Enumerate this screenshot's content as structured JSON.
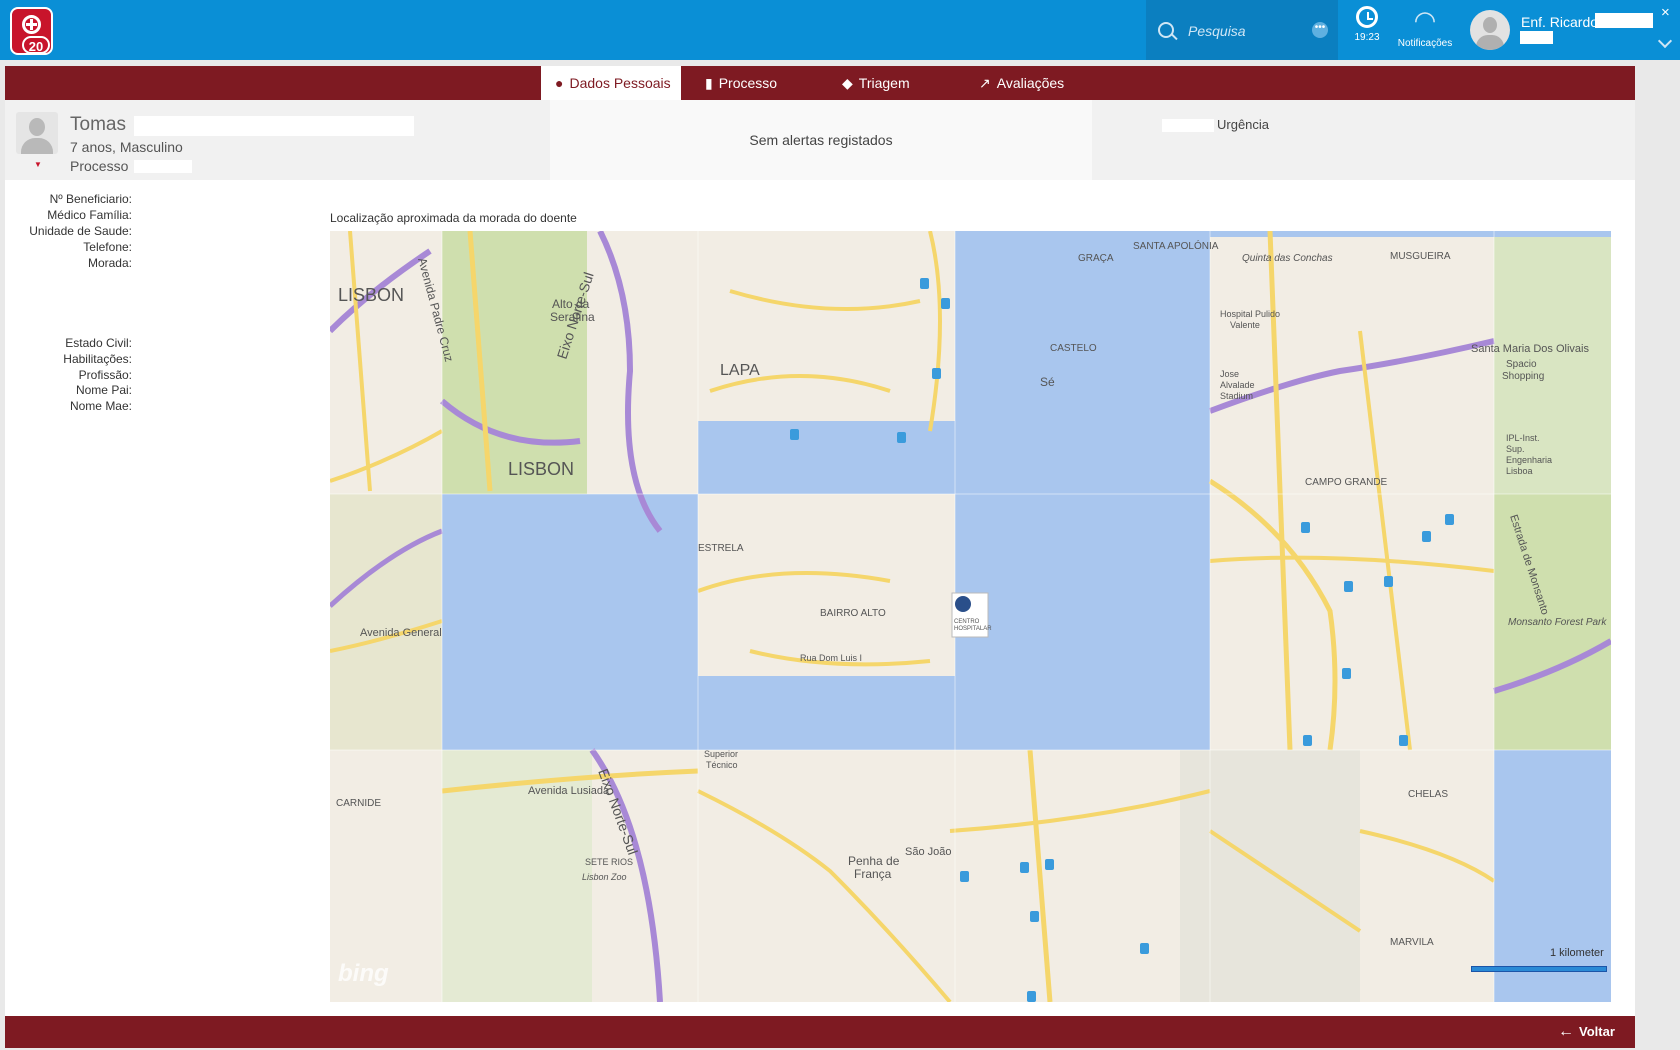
{
  "topbar": {
    "badge_count": "20",
    "search_placeholder": "Pesquisa",
    "clock_time": "19:23",
    "notifications_label": "Notificações",
    "user_name": "Enf. Ricardo",
    "close_symbol": "×"
  },
  "tabs": [
    {
      "label": "Dados Pessoais",
      "icon": "person-icon"
    },
    {
      "label": "Processo",
      "icon": "document-icon"
    },
    {
      "label": "Triagem",
      "icon": "tag-icon"
    },
    {
      "label": "Avaliações",
      "icon": "trend-icon"
    }
  ],
  "patient": {
    "name": "Tomas",
    "age_sex": "7 anos, Masculino",
    "process_label": "Processo",
    "alerts": "Sem alertas registados",
    "urgency": "Urgência"
  },
  "fields": [
    "Nº Beneficiario:",
    "Médico Família:",
    "Unidade de Saude:",
    "Telefone:",
    "Morada:",
    "Estado Civil:",
    "Habilitações:",
    "Profissão:",
    "Nome Pai:",
    "Nome Mae:"
  ],
  "map": {
    "title": "Localização aproximada da morada do doente",
    "scale_label": "1 kilometer",
    "provider": "bing",
    "labels": [
      "LISBON",
      "Alto da Serafina",
      "LAPA",
      "Sé",
      "CASTELO",
      "GRAÇA",
      "SANTA APOLÓNIA",
      "Quinta das Conchas",
      "MUSGUEIRA",
      "Santa Maria Dos Olivais",
      "Spacio Shopping",
      "CAMPO GRANDE",
      "Monsanto Forest Park",
      "Estrada de Monsanto",
      "ESTRELA",
      "BAIRRO ALTO",
      "Rua Dom Luis I",
      "Avenida General",
      "Avenida Lusiada",
      "Eixo Norte-Sul",
      "Lisbon Zoo",
      "SETE RIOS",
      "Penha de França",
      "São João",
      "CHELAS",
      "MARVILA",
      "CARNIDE",
      "Avenida Padre Cruz",
      "Superior Técnico",
      "IPL-Inst. Sup. Engenharia Lisboa",
      "Jose Alvalade Stadium",
      "Hospital Pulido Valente"
    ],
    "marker_label": "CENTRO HOSPITALAR DE LISBOA CENTRAL, EPE"
  },
  "footer": {
    "back_label": "Voltar"
  },
  "colors": {
    "topbar": "#0a8fd6",
    "accent": "#7e1a22",
    "logo": "#c8142b",
    "water": "#a9c6ee",
    "park": "#cfdfae"
  }
}
